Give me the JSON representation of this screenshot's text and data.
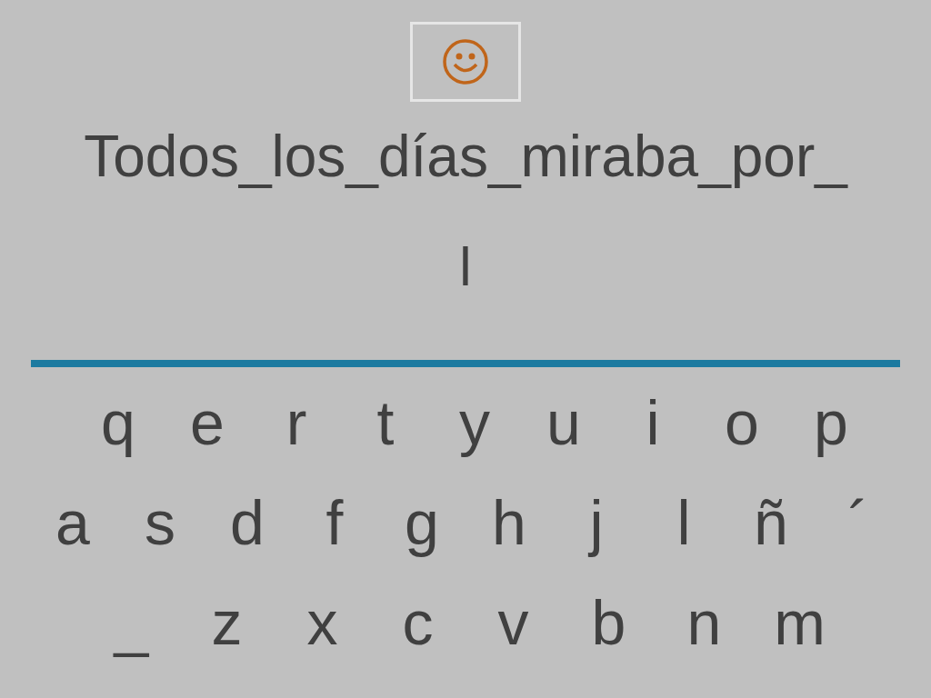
{
  "prompt": "Todos_los_días_miraba_por_",
  "answer": {
    "value": "l"
  },
  "keyboard": {
    "rows": [
      [
        "q",
        "e",
        "r",
        "t",
        "y",
        "u",
        "i",
        "o",
        "p"
      ],
      [
        "a",
        "s",
        "d",
        "f",
        "g",
        "h",
        "j",
        "l",
        "ñ",
        "´"
      ],
      [
        "_",
        "z",
        "x",
        "c",
        "v",
        "b",
        "n",
        "m"
      ]
    ]
  }
}
